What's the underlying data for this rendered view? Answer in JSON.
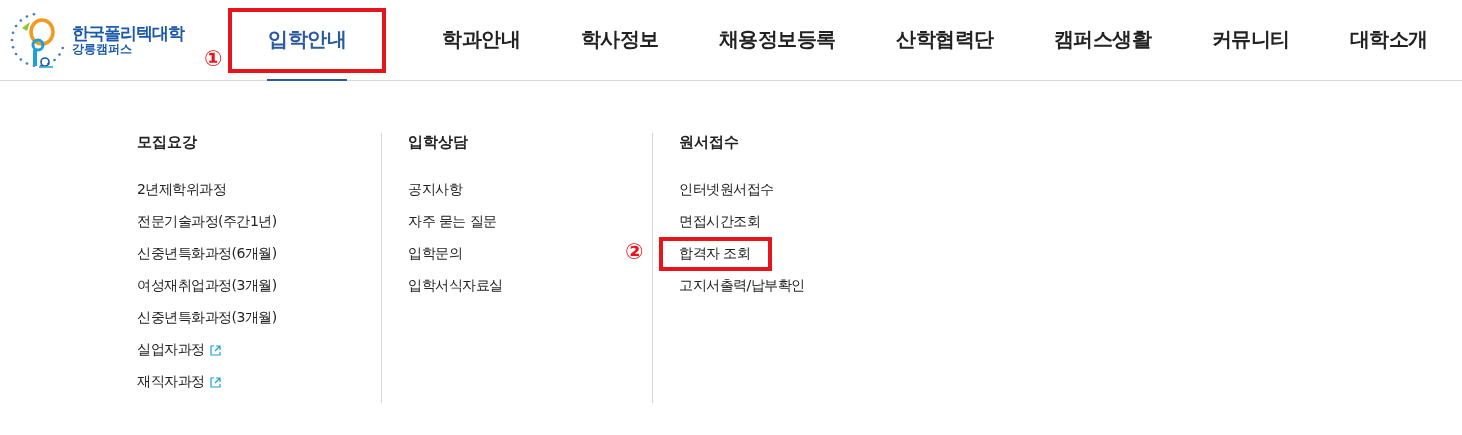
{
  "logo": {
    "name": "한국폴리텍대학",
    "campus": "강릉캠퍼스"
  },
  "nav": [
    {
      "label": "입학안내",
      "selected": true,
      "marked": true,
      "marker": "①"
    },
    {
      "label": "학과안내",
      "selected": false,
      "marked": false
    },
    {
      "label": "학사정보",
      "selected": false,
      "marked": false
    },
    {
      "label": "채용정보등록",
      "selected": false,
      "marked": false
    },
    {
      "label": "산학협력단",
      "selected": false,
      "marked": false
    },
    {
      "label": "캠퍼스생활",
      "selected": false,
      "marked": false
    },
    {
      "label": "커뮤니티",
      "selected": false,
      "marked": false
    },
    {
      "label": "대학소개",
      "selected": false,
      "marked": false
    }
  ],
  "menu": [
    {
      "title": "모집요강",
      "items": [
        {
          "label": "2년제학위과정",
          "external": false,
          "marked": false
        },
        {
          "label": "전문기술과정(주간1년)",
          "external": false,
          "marked": false
        },
        {
          "label": "신중년특화과정(6개월)",
          "external": false,
          "marked": false
        },
        {
          "label": "여성재취업과정(3개월)",
          "external": false,
          "marked": false
        },
        {
          "label": "신중년특화과정(3개월)",
          "external": false,
          "marked": false
        },
        {
          "label": "실업자과정",
          "external": true,
          "marked": false
        },
        {
          "label": "재직자과정",
          "external": true,
          "marked": false
        }
      ]
    },
    {
      "title": "입학상담",
      "items": [
        {
          "label": "공지사항",
          "external": false,
          "marked": false
        },
        {
          "label": "자주 묻는 질문",
          "external": false,
          "marked": false
        },
        {
          "label": "입학문의",
          "external": false,
          "marked": false
        },
        {
          "label": "입학서식자료실",
          "external": false,
          "marked": false
        }
      ]
    },
    {
      "title": "원서접수",
      "items": [
        {
          "label": "인터넷원서접수",
          "external": false,
          "marked": false
        },
        {
          "label": "면접시간조회",
          "external": false,
          "marked": false
        },
        {
          "label": "합격자 조회",
          "external": false,
          "marked": true,
          "marker": "②"
        },
        {
          "label": "고지서출력/납부확인",
          "external": false,
          "marked": false
        }
      ]
    }
  ]
}
